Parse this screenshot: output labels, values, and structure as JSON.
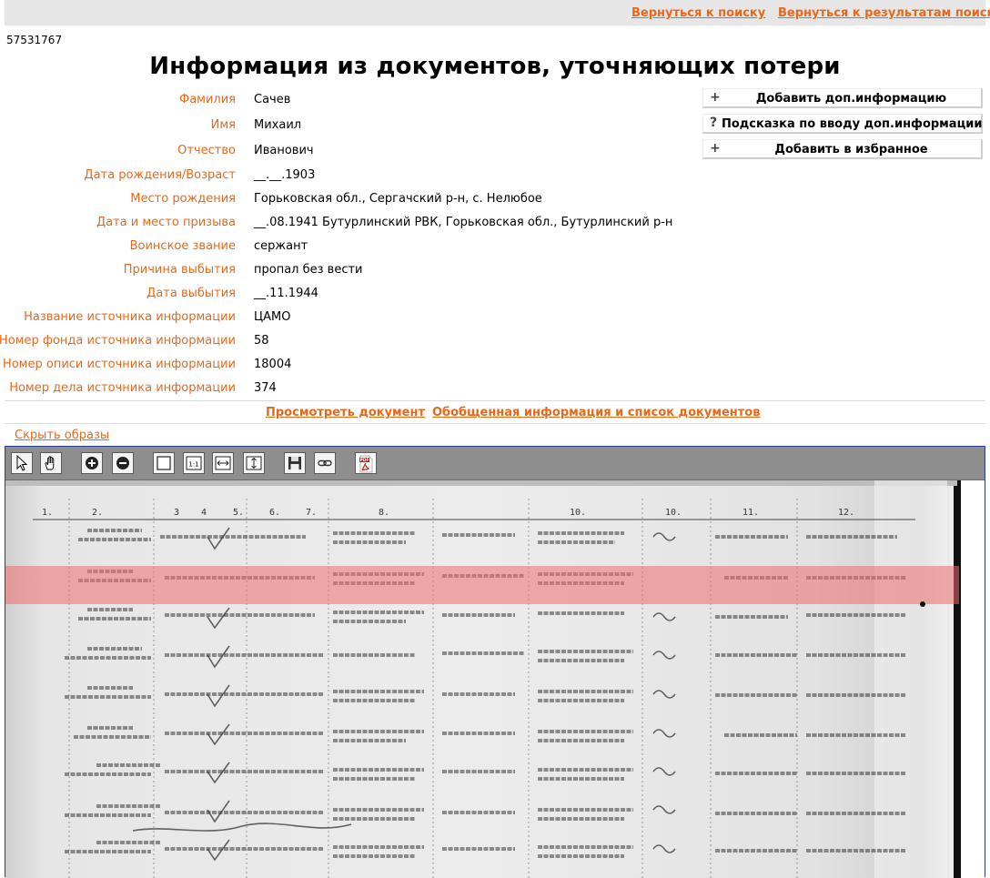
{
  "nav": {
    "back_to_search": "Вернуться к поиску",
    "back_to_results": "Вернуться к результатам поиска"
  },
  "record_id": "57531767",
  "page_title": "Информация из документов, уточняющих потери",
  "fields": [
    {
      "label": "Фамилия",
      "value": "Сачев"
    },
    {
      "label": "Имя",
      "value": "Михаил"
    },
    {
      "label": "Отчество",
      "value": "Иванович"
    },
    {
      "label": "Дата рождения/Возраст",
      "value": "__.__.1903"
    },
    {
      "label": "Место рождения",
      "value": "Горьковская обл., Сергачский р-н, с. Нелюбое"
    },
    {
      "label": "Дата и место призыва",
      "value": "__.08.1941 Бутурлинский РВК, Горьковская обл., Бутурлинский р-н"
    },
    {
      "label": "Воинское звание",
      "value": "сержант"
    },
    {
      "label": "Причина выбытия",
      "value": "пропал без вести"
    },
    {
      "label": "Дата выбытия",
      "value": "__.11.1944"
    },
    {
      "label": "Название источника информации",
      "value": "ЦАМО"
    },
    {
      "label": "Номер фонда источника информации",
      "value": "58"
    },
    {
      "label": "Номер описи источника информации",
      "value": "18004"
    },
    {
      "label": "Номер дела источника информации",
      "value": "374"
    }
  ],
  "actions": {
    "add_info": {
      "icon": "+",
      "label": "Добавить доп.информацию"
    },
    "hint": {
      "icon": "?",
      "label": "Подсказка по вводу доп.информации"
    },
    "favorites": {
      "icon": "+",
      "label": "Добавить в избранное"
    }
  },
  "links": {
    "view_document": "Просмотреть документ",
    "summary": "Обобщенная информация и список документов",
    "hide_images": "Скрыть образы"
  },
  "toolbar": [
    "pointer-tool",
    "hand-tool",
    "zoom-in",
    "zoom-out",
    "fit-page",
    "actual-size",
    "fit-width",
    "fit-height",
    "save",
    "link",
    "pdf-export"
  ],
  "colors": {
    "accent": "#e8681a",
    "highlight": "#ee6e6e",
    "toolbar": "#8e8e8e",
    "viewer_border": "#2a3a9a"
  }
}
